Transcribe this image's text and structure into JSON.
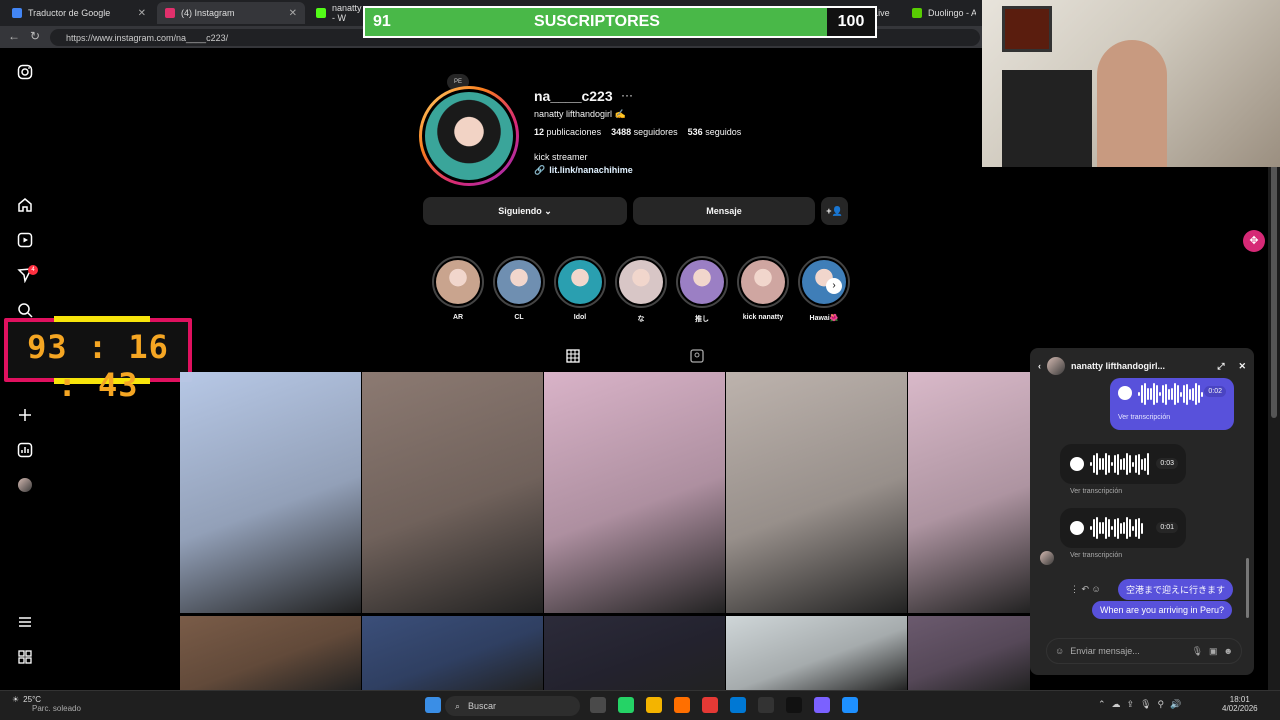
{
  "tabs": [
    {
      "label": "Traductor de Google",
      "color": "#4285f4"
    },
    {
      "label": "(4) Instagram",
      "color": "#e1306c"
    },
    {
      "label": "nanatty - W",
      "color": "#53fc18"
    },
    {
      "label": "m - Watch Live",
      "color": "#888888"
    },
    {
      "label": "Duolingo - Aprend",
      "color": "#58cc02"
    }
  ],
  "url": "https://www.instagram.com/na____c223/",
  "subs": {
    "current": "91",
    "label": "SUSCRIPTORES",
    "goal": "100"
  },
  "timer": "93 : 16 : 43",
  "sidebar": {
    "notif_count": "4"
  },
  "profile": {
    "note": "PE",
    "username": "na____c223",
    "fullname": "nanatty lifthandogirl ✍️",
    "posts": "12",
    "posts_label": "publicaciones",
    "followers": "3488",
    "followers_label": "seguidores",
    "following": "536",
    "following_label": "seguidos",
    "bio": "kick streamer",
    "link": "lit.link/nanachihime",
    "follow_btn": "Siguiendo ⌄",
    "message_btn": "Mensaje",
    "add_btn": "+👤"
  },
  "highlights": [
    {
      "label": "AR",
      "color": "#c9a48e"
    },
    {
      "label": "CL",
      "color": "#6f8fb1"
    },
    {
      "label": "Idol",
      "color": "#2a9fb0"
    },
    {
      "label": "な",
      "color": "#d8c6c6"
    },
    {
      "label": "推し",
      "color": "#9b7fc4"
    },
    {
      "label": "kick nanatty",
      "color": "#cfa6a1"
    },
    {
      "label": "Hawai🌺",
      "color": "#3f7eb8"
    }
  ],
  "grid_colors": [
    [
      "#b7c8e6",
      "#8c7a72",
      "#d9b3c8",
      "#bdb3ad",
      "#d9b9c9"
    ],
    [
      "#7a5c48",
      "#3b4f7a",
      "#2c2b3a",
      "#cfd6d8",
      "#6b5a6e"
    ]
  ],
  "chat": {
    "name": "nanatty lifthandogirl...",
    "voice1_dur": "0:02",
    "voice2_dur": "0:03",
    "voice3_dur": "0:01",
    "transcript": "Ver transcripción",
    "msg_jp": "空港まで迎えに行きます",
    "msg_en": "When are you arriving in Peru?",
    "placeholder": "Enviar mensaje..."
  },
  "taskbar": {
    "temp": "25°C",
    "weather": "Parc. soleado",
    "search": "Buscar",
    "time": "18:01",
    "date": "4/02/2026"
  }
}
